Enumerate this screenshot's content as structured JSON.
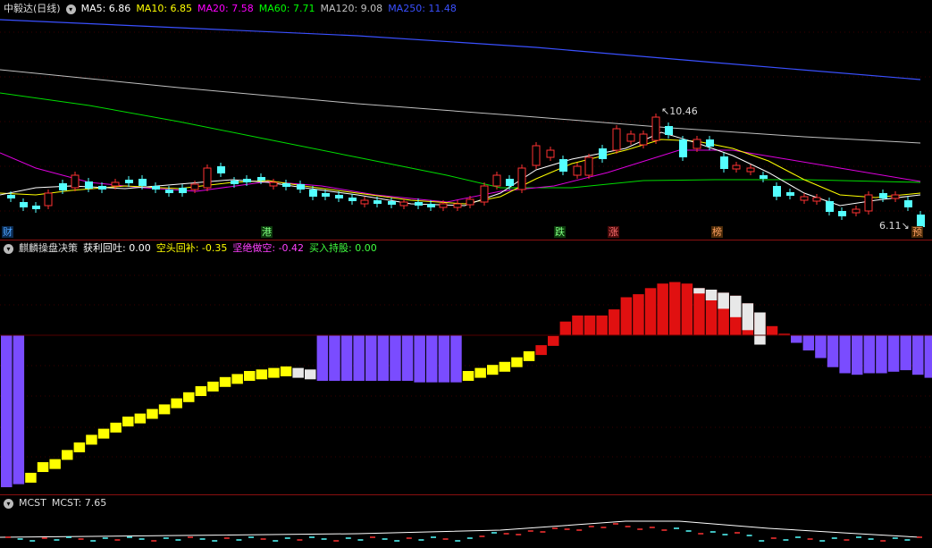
{
  "main": {
    "title": "中毅达(日线)",
    "ma": [
      {
        "label": "MA5: 6.86",
        "color": "#ffffff"
      },
      {
        "label": "MA10: 6.85",
        "color": "#ffff00"
      },
      {
        "label": "MA20: 7.58",
        "color": "#ff00ff"
      },
      {
        "label": "MA60: 7.71",
        "color": "#00ff00"
      },
      {
        "label": "MA120: 9.08",
        "color": "#c0c0c0"
      },
      {
        "label": "MA250: 11.48",
        "color": "#3a50ff"
      }
    ],
    "high_label": "10.46",
    "low_label": "6.11",
    "event_tags": [
      {
        "text": "财",
        "color": "#4fa3ff",
        "bg": "#0a2a50"
      },
      {
        "text": "港",
        "color": "#7fff7f",
        "bg": "#0c3a0c"
      },
      {
        "text": "跌",
        "color": "#7fff7f",
        "bg": "#0c3a0c"
      },
      {
        "text": "涨",
        "color": "#ff7070",
        "bg": "#4a0a0a"
      },
      {
        "text": "榜",
        "color": "#ffa060",
        "bg": "#4a2a08"
      },
      {
        "text": "预",
        "color": "#ffa060",
        "bg": "#4a2a08"
      }
    ]
  },
  "indicator": {
    "title": "麒麟操盘决策",
    "items": [
      {
        "label": "获利回吐: 0.00",
        "color": "#ffffff"
      },
      {
        "label": "空头回补: -0.35",
        "color": "#ffff00"
      },
      {
        "label": "坚绝做空: -0.42",
        "color": "#ff40ff"
      },
      {
        "label": "买入持股: 0.00",
        "color": "#40ff40"
      }
    ]
  },
  "mcst": {
    "title": "MCST",
    "value_label": "MCST: 7.65"
  },
  "colors": {
    "up_candle": "#ff3232",
    "down_candle": "#54ffff",
    "separator": "#8a1010",
    "bar_red": "#e01010",
    "bar_purple": "#7a4cff",
    "bar_yellow": "#ffff00",
    "bar_white": "#e8e8e8"
  },
  "chart_data": [
    {
      "type": "bar",
      "title": "麒麟操盘决策",
      "values": [
        -1.0,
        -0.98,
        -0.97,
        -0.9,
        -0.88,
        -0.82,
        -0.77,
        -0.72,
        -0.68,
        -0.64,
        -0.6,
        -0.58,
        -0.55,
        -0.52,
        -0.48,
        -0.44,
        -0.4,
        -0.37,
        -0.34,
        -0.32,
        -0.3,
        -0.29,
        -0.28,
        -0.27,
        -0.28,
        -0.29,
        -0.3,
        -0.3,
        -0.3,
        -0.3,
        -0.3,
        -0.3,
        -0.3,
        -0.3,
        -0.31,
        -0.31,
        -0.31,
        -0.31,
        -0.3,
        -0.28,
        -0.26,
        -0.24,
        -0.21,
        -0.17,
        -0.13,
        -0.07,
        0.09,
        0.13,
        0.13,
        0.13,
        0.17,
        0.25,
        0.27,
        0.31,
        0.34,
        0.35,
        0.34,
        0.31,
        0.3,
        0.28,
        0.26,
        0.21,
        0.15,
        0.06,
        0.01,
        -0.05,
        -0.1,
        -0.15,
        -0.21,
        -0.25,
        -0.26,
        -0.25,
        -0.25,
        -0.24,
        -0.23,
        -0.26,
        -0.28
      ],
      "colors": [
        "p",
        "p",
        "y",
        "y",
        "y",
        "y",
        "y",
        "y",
        "y",
        "y",
        "y",
        "y",
        "y",
        "y",
        "y",
        "y",
        "y",
        "y",
        "y",
        "y",
        "y",
        "y",
        "y",
        "y",
        "w",
        "w",
        "p",
        "p",
        "p",
        "p",
        "p",
        "p",
        "p",
        "p",
        "p",
        "p",
        "p",
        "p",
        "y",
        "y",
        "y",
        "y",
        "y",
        "y",
        "r",
        "r",
        "r",
        "r",
        "r",
        "r",
        "r",
        "r",
        "r",
        "r",
        "r",
        "r",
        "r",
        "r",
        "r",
        "r",
        "r",
        "r",
        "r",
        "r",
        "r",
        "p",
        "p",
        "p",
        "p",
        "p",
        "p",
        "p",
        "p",
        "p",
        "p",
        "p",
        "p"
      ]
    },
    {
      "type": "line",
      "title": "MCST",
      "series": [
        {
          "name": "MCST",
          "values": [
            7.65
          ]
        }
      ]
    }
  ]
}
